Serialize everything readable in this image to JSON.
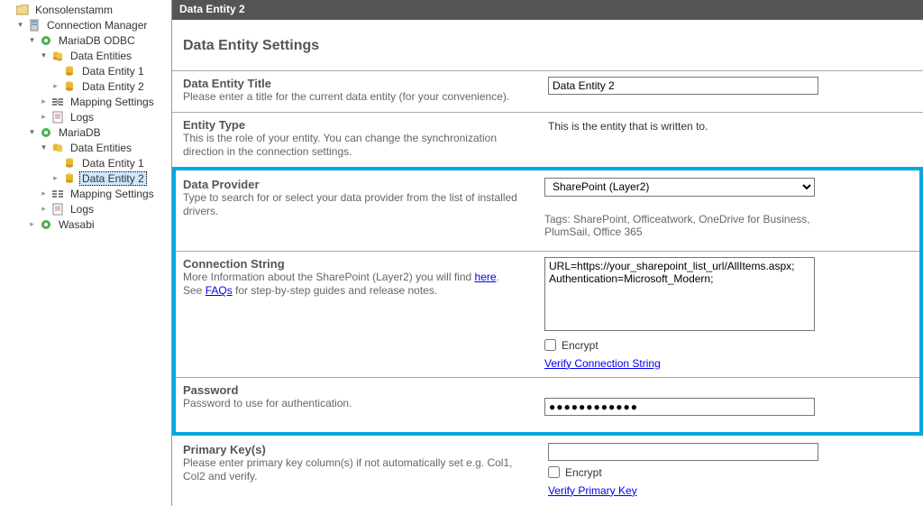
{
  "tree": {
    "root": "Konsolenstamm",
    "connection_manager": "Connection Manager",
    "mariadb_odbc": "MariaDB ODBC",
    "mariadb": "MariaDB",
    "wasabi": "Wasabi",
    "data_entities": "Data Entities",
    "data_entity_1": "Data Entity 1",
    "data_entity_2": "Data Entity 2",
    "mapping_settings": "Mapping Settings",
    "logs": "Logs"
  },
  "titlebar": "Data Entity 2",
  "heading": "Data Entity Settings",
  "title_row": {
    "label": "Data Entity Title",
    "desc": "Please enter a title for the current data entity (for your convenience).",
    "value": "Data Entity 2"
  },
  "entity_type_row": {
    "label": "Entity Type",
    "desc": "This is the role of your entity. You can change the synchronization direction in the connection settings.",
    "value": "This is the entity that is written to."
  },
  "provider_row": {
    "label": "Data Provider",
    "desc": "Type to search for or select your data provider from the list of installed drivers.",
    "value": "SharePoint (Layer2)",
    "tags": "Tags: SharePoint, Officeatwork, OneDrive for Business, PlumSail, Office 365"
  },
  "conn_row": {
    "label": "Connection String",
    "desc_a": "More Information about the SharePoint (Layer2) you will find ",
    "desc_here": "here",
    "desc_b": ". See ",
    "desc_faqs": "FAQs",
    "desc_c": " for step-by-step guides and release notes.",
    "value": "URL=https://your_sharepoint_list_url/AllItems.aspx;\nAuthentication=Microsoft_Modern;",
    "encrypt": "Encrypt",
    "verify": "Verify Connection String"
  },
  "password_row": {
    "label": "Password",
    "desc": "Password to use for authentication.",
    "value": "●●●●●●●●●●●●"
  },
  "pk_row": {
    "label": "Primary Key(s)",
    "desc": "Please enter primary key column(s) if not automatically set e.g. Col1, Col2 and verify.",
    "encrypt": "Encrypt",
    "verify": "Verify Primary Key"
  }
}
